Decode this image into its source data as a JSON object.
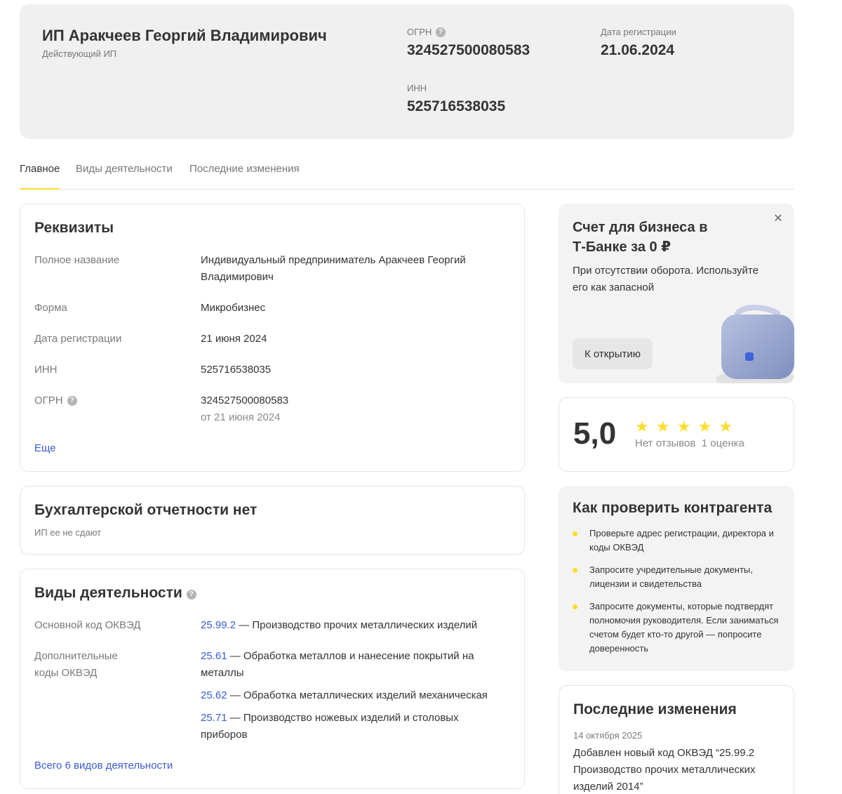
{
  "company": {
    "name": "ИП Аракчеев Георгий Владимирович",
    "status": "Действующий ИП",
    "ogrn_label": "ОГРН",
    "ogrn": "324527500080583",
    "inn_label": "ИНН",
    "inn": "525716538035",
    "reg_date_label": "Дата регистрации",
    "reg_date": "21.06.2024"
  },
  "tabs": [
    "Главное",
    "Виды деятельности",
    "Последние изменения"
  ],
  "requisites": {
    "title": "Реквизиты",
    "rows": [
      {
        "label": "Полное название",
        "value": "Индивидуальный предприниматель Аракчеев Георгий Владимирович"
      },
      {
        "label": "Форма",
        "value": "Микробизнес"
      },
      {
        "label": "Дата регистрации",
        "value": "21 июня 2024"
      },
      {
        "label": "ИНН",
        "value": "525716538035"
      },
      {
        "label": "ОГРН",
        "value": "324527500080583",
        "sub": "от 21 июня 2024"
      }
    ],
    "more_link": "Еще"
  },
  "accounting": {
    "title": "Бухгалтерской отчетности нет",
    "subtitle": "ИП ее не сдают"
  },
  "activities": {
    "title": "Виды деятельности",
    "main_label": "Основной код ОКВЭД",
    "main": {
      "code": "25.99.2",
      "desc": " — Производство прочих металлических изделий"
    },
    "extra_label": "Дополнительные коды ОКВЭД",
    "extra": [
      {
        "code": "25.61",
        "desc": " — Обработка металлов и нанесение покрытий на металлы"
      },
      {
        "code": "25.62",
        "desc": " — Обработка металлических изделий механическая"
      },
      {
        "code": "25.71",
        "desc": " — Производство ножевых изделий и столовых приборов"
      }
    ],
    "all_link": "Всего 6 видов деятельности"
  },
  "promo": {
    "title": "Счет для бизнеса в Т‑Банке за 0 ₽",
    "desc": "При отсутствии оборота. Используйте его как запасной",
    "button": "К открытию",
    "close_icon": "close-icon",
    "accent": "#8e9ec9"
  },
  "rating": {
    "score": "5,0",
    "stars": 5,
    "stars_text": "★ ★ ★ ★ ★",
    "reviews": "Нет отзывов",
    "count": "1 оценка",
    "star_color": "#ffdd2d"
  },
  "check": {
    "title": "Как проверить контрагента",
    "items": [
      "Проверьте адрес регистрации, директора и коды ОКВЭД",
      "Запросите учредительные документы, лицензии и свидетельства",
      "Запросите документы, которые подтвердят полномочия руководителя. Если заниматься счетом будет кто‑то другой — попросите доверенность"
    ]
  },
  "changes": {
    "title": "Последние изменения",
    "date": "14 октября 2025",
    "text": "Добавлен новый код ОКВЭД “25.99.2 Производство прочих металлических изделий 2014”"
  },
  "colors": {
    "accent_yellow": "#ffdd2d",
    "link": "#3a5bd9"
  }
}
